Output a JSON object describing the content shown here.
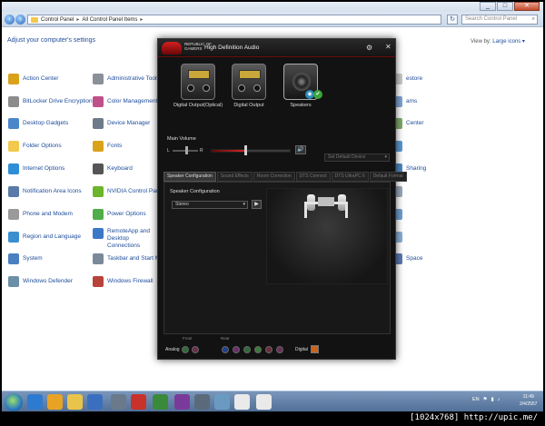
{
  "window": {
    "address_path": [
      "Control Panel",
      "All Control Panel Items"
    ],
    "search_placeholder": "Search Control Panel",
    "min_label": "_",
    "max_label": "□",
    "close_label": "✕"
  },
  "header": {
    "title": "Adjust your computer's settings",
    "view_by_label": "View by:",
    "view_by_value": "Large icons ▾"
  },
  "control_panel_items": [
    {
      "label": "Action Center",
      "color": "#d9a21b"
    },
    {
      "label": "BitLocker Drive Encryption",
      "color": "#8c8c8c"
    },
    {
      "label": "Desktop Gadgets",
      "color": "#4a86c9"
    },
    {
      "label": "Folder Options",
      "color": "#f2c94c"
    },
    {
      "label": "Internet Options",
      "color": "#2e8fd6"
    },
    {
      "label": "Notification Area Icons",
      "color": "#5a7ba8"
    },
    {
      "label": "Phone and Modem",
      "color": "#9a9a9a"
    },
    {
      "label": "Region and Language",
      "color": "#3a8fd0"
    },
    {
      "label": "System",
      "color": "#4a7fc0"
    },
    {
      "label": "Windows Defender",
      "color": "#6b8fa8"
    },
    {
      "label": "Administrative Tools",
      "color": "#8a8f98"
    },
    {
      "label": "Color Management",
      "color": "#c0508a"
    },
    {
      "label": "Device Manager",
      "color": "#6d7a8a"
    },
    {
      "label": "Fonts",
      "color": "#d9a21b"
    },
    {
      "label": "Keyboard",
      "color": "#555555"
    },
    {
      "label": "NVIDIA Control Panel",
      "color": "#6cb52d"
    },
    {
      "label": "Power Options",
      "color": "#4fae4a"
    },
    {
      "label": "RemoteApp and Desktop Connections",
      "color": "#3c78c8"
    },
    {
      "label": "Taskbar and Start Menu",
      "color": "#7a8a9a"
    },
    {
      "label": "Windows Firewall",
      "color": "#b8433a"
    }
  ],
  "right_column_fragments": [
    "estore",
    "ams",
    "Center",
    "Sharing",
    "Space"
  ],
  "rog": {
    "brand": "REPUBLIC OF GAMERS",
    "app_title": "High Definition Audio",
    "devices": [
      {
        "label": "Digital Output(Optical)",
        "active": false
      },
      {
        "label": "Digital Output",
        "active": false
      },
      {
        "label": "Speakers",
        "active": true
      }
    ],
    "main_volume_label": "Main Volume",
    "balance_left": "L",
    "balance_right": "R",
    "volume_level": 0.42,
    "balance_level": 0.5,
    "set_default_label": "Set Default Device",
    "tabs": [
      "Speaker Configuration",
      "Sound Effects",
      "Room Correction",
      "DTS Connect",
      "DTS UltraPC II",
      "Default Format"
    ],
    "active_tab": 0,
    "config_label": "Speaker Configuration",
    "config_value": "Stereo",
    "analog_label": "Analog",
    "front_label": "Front",
    "rear_label": "Rear",
    "digital_label": "Digital",
    "jack_colors_front": [
      "#2f6a3a",
      "#6a2f4a"
    ],
    "jack_colors_rear": [
      "#1f3f8a",
      "#6a2f6a",
      "#2f6a3a",
      "#3a7a3a",
      "#6a2f3a",
      "#6a2f5a"
    ]
  },
  "taskbar": {
    "language": "EN",
    "time": "11:49",
    "date": "2/4/2557",
    "apps": [
      "#2d7bd0",
      "#e8a325",
      "#e8c44a",
      "#3a6fc0",
      "#6a7a8a",
      "#c8322a",
      "#3a8a3a",
      "#7a3a9a",
      "#5a6a7a",
      "#6a9ac0",
      "#eaeaea"
    ]
  },
  "watermark": "[1024x768] http://upic.me/"
}
